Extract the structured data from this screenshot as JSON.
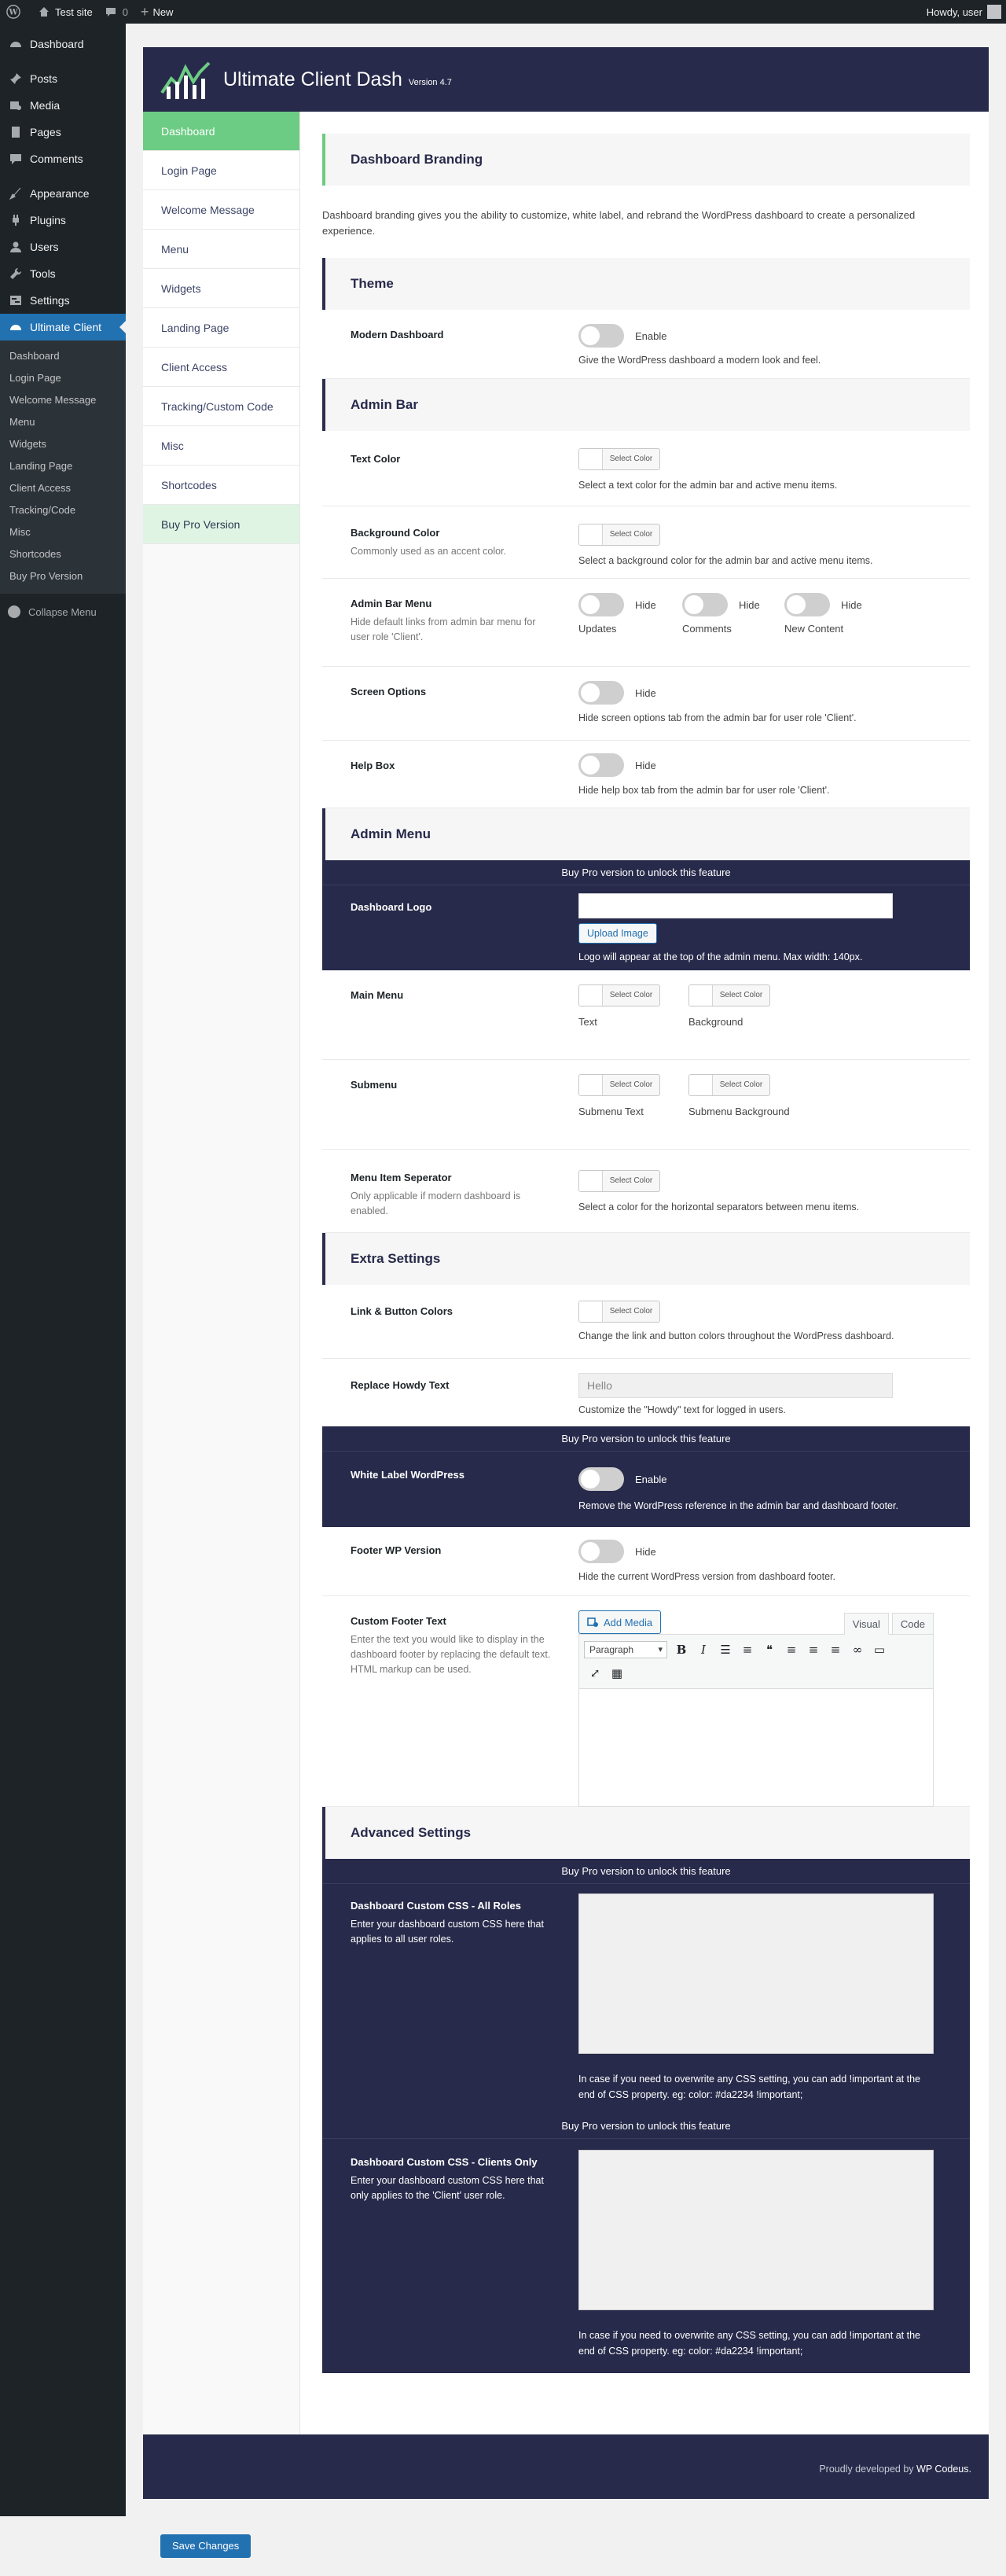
{
  "adminbar": {
    "site": "Test site",
    "comments_count": "0",
    "new": "New",
    "howdy": "Howdy, user"
  },
  "sidebar": {
    "items": [
      {
        "label": "Dashboard",
        "icon": "dashboard-icon"
      },
      {
        "label": "Posts",
        "icon": "pin-icon"
      },
      {
        "label": "Media",
        "icon": "media-icon"
      },
      {
        "label": "Pages",
        "icon": "page-icon"
      },
      {
        "label": "Comments",
        "icon": "comment-icon"
      },
      {
        "label": "Appearance",
        "icon": "brush-icon"
      },
      {
        "label": "Plugins",
        "icon": "plug-icon"
      },
      {
        "label": "Users",
        "icon": "user-icon"
      },
      {
        "label": "Tools",
        "icon": "wrench-icon"
      },
      {
        "label": "Settings",
        "icon": "settings-icon"
      },
      {
        "label": "Ultimate Client",
        "icon": "dashboard-icon"
      }
    ],
    "submenu": [
      "Dashboard",
      "Login Page",
      "Welcome Message",
      "Menu",
      "Widgets",
      "Landing Page",
      "Client Access",
      "Tracking/Code",
      "Misc",
      "Shortcodes",
      "Buy Pro Version"
    ],
    "collapse": "Collapse Menu"
  },
  "plugin": {
    "title": "Ultimate Client Dash",
    "version": "Version 4.7",
    "tabs": [
      "Dashboard",
      "Login Page",
      "Welcome Message",
      "Menu",
      "Widgets",
      "Landing Page",
      "Client Access",
      "Tracking/Custom Code",
      "Misc",
      "Shortcodes",
      "Buy Pro Version"
    ]
  },
  "content": {
    "branding_title": "Dashboard Branding",
    "branding_desc": "Dashboard branding gives you the ability to customize, white label, and rebrand the WordPress dashboard to create a personalized experience.",
    "theme_title": "Theme",
    "modern_label": "Modern Dashboard",
    "enable": "Enable",
    "modern_help": "Give the WordPress dashboard a modern look and feel.",
    "adminbar_title": "Admin Bar",
    "text_color_label": "Text Color",
    "select_color": "Select Color",
    "text_color_help": "Select a text color for the admin bar and active menu items.",
    "bg_color_label": "Background Color",
    "bg_color_sub": "Commonly used as an accent color.",
    "bg_color_help": "Select a background color for the admin bar and active menu items.",
    "abm_label": "Admin Bar Menu",
    "abm_sub": "Hide default links from admin bar menu for user role 'Client'.",
    "hide": "Hide",
    "abm_caps": [
      "Updates",
      "Comments",
      "New Content"
    ],
    "screen_label": "Screen Options",
    "screen_help": "Hide screen options tab from the admin bar for user role 'Client'.",
    "helpbox_label": "Help Box",
    "helpbox_help": "Hide help box tab from the admin bar for user role 'Client'.",
    "adminmenu_title": "Admin Menu",
    "pro_banner": "Buy Pro version to unlock this feature",
    "logo_label": "Dashboard Logo",
    "upload": "Upload Image",
    "logo_help": "Logo will appear at the top of the admin menu. Max width: 140px.",
    "main_menu_label": "Main Menu",
    "main_menu_caps": [
      "Text",
      "Background"
    ],
    "submenu_label": "Submenu",
    "submenu_caps": [
      "Submenu Text",
      "Submenu Background"
    ],
    "sep_label": "Menu Item Seperator",
    "sep_sub": "Only applicable if modern dashboard is enabled.",
    "sep_help": "Select a color for the horizontal separators between menu items.",
    "extra_title": "Extra Settings",
    "link_label": "Link & Button Colors",
    "link_help": "Change the link and button colors throughout the WordPress dashboard.",
    "howdy_label": "Replace Howdy Text",
    "howdy_value": "Hello",
    "howdy_help": "Customize the \"Howdy\" text for logged in users.",
    "wl_label": "White Label WordPress",
    "wl_help": "Remove the WordPress reference in the admin bar and dashboard footer.",
    "footer_ver_label": "Footer WP Version",
    "footer_ver_help": "Hide the current WordPress version from dashboard footer.",
    "footer_text_label": "Custom Footer Text",
    "footer_text_sub": "Enter the text you would like to display in the dashboard footer by replacing the default text. HTML markup can be used.",
    "add_media": "Add Media",
    "visual": "Visual",
    "code": "Code",
    "paragraph": "Paragraph",
    "advanced_title": "Advanced Settings",
    "css_all_label": "Dashboard Custom CSS - All Roles",
    "css_all_sub": "Enter your dashboard custom CSS here that applies to all user roles.",
    "css_help": "In case if you need to overwrite any CSS setting, you can add !important at the end of CSS property. eg: color: #da2234 !important;",
    "css_client_label": "Dashboard Custom CSS - Clients Only",
    "css_client_sub": "Enter your dashboard custom CSS here that only applies to the 'Client' user role."
  },
  "footer": {
    "credit_prefix": "Proudly developed by",
    "credit_link": "WP Codeus",
    "credit_suffix": "."
  },
  "save": "Save Changes",
  "colors": {
    "navy": "#272a4a",
    "green": "#6ccc83",
    "wp_blue": "#2271b1",
    "admin_dark": "#1d2327"
  }
}
